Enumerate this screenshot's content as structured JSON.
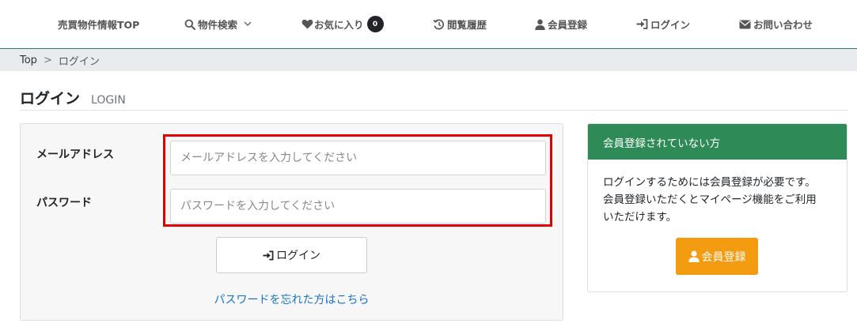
{
  "nav": {
    "items": [
      {
        "label": "売買物件情報TOP",
        "icon": ""
      },
      {
        "label": "物件検索",
        "icon": "search-icon",
        "dropdown": true
      },
      {
        "label": "お気に入り",
        "icon": "heart-icon",
        "badge": "0"
      },
      {
        "label": "閲覧履歴",
        "icon": "history-icon"
      },
      {
        "label": "会員登録",
        "icon": "user-icon"
      },
      {
        "label": "ログイン",
        "icon": "sign-in-icon"
      },
      {
        "label": "お問い合わせ",
        "icon": "envelope-icon"
      }
    ]
  },
  "breadcrumb": {
    "home": "Top",
    "separator": ">",
    "current": "ログイン"
  },
  "page": {
    "title": "ログイン",
    "subtitle": "LOGIN"
  },
  "login_form": {
    "email_label": "メールアドレス",
    "email_placeholder": "メールアドレスを入力してください",
    "email_value": "",
    "password_label": "パスワード",
    "password_placeholder": "パスワードを入力してください",
    "password_value": "",
    "login_button": "ログイン",
    "forgot_link": "パスワードを忘れた方はこちら"
  },
  "register_box": {
    "header": "会員登録されていない方",
    "body_line1": "ログインするためには会員登録が必要です。",
    "body_line2": "会員登録いただくとマイページ機能をご利用",
    "body_line3": "いただけます。",
    "button": "会員登録"
  },
  "colors": {
    "accent_green": "#2e8b57",
    "register_orange": "#f39c12",
    "highlight_red": "#e00000",
    "link_blue": "#1a73c9"
  }
}
